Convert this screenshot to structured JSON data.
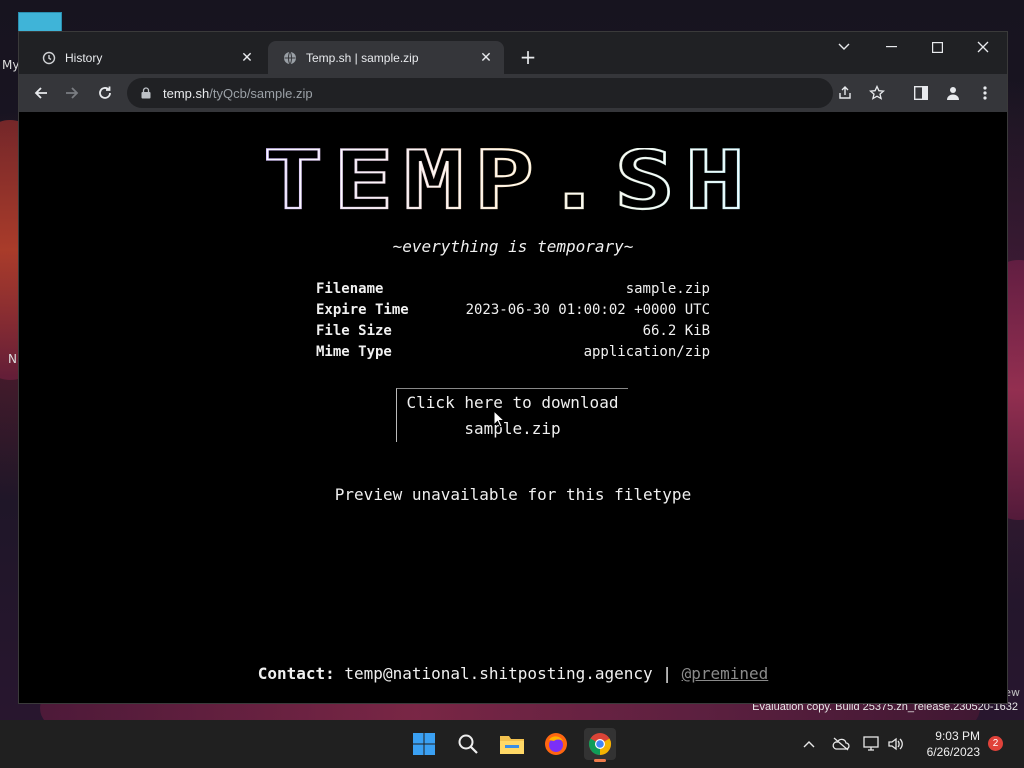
{
  "desktop": {
    "left_label_top": "My",
    "left_label_mid": "N",
    "watermark_small": "ew",
    "watermark": "Evaluation copy. Build 25375.zn_release.230520-1632"
  },
  "browser": {
    "tabs": [
      {
        "label": "History",
        "icon": "history-icon",
        "active": false
      },
      {
        "label": "Temp.sh | sample.zip",
        "icon": "globe-icon",
        "active": true
      }
    ],
    "url_host": "temp.sh",
    "url_path": "/tyQcb/sample.zip"
  },
  "page": {
    "logo_text": "TEMP.SH",
    "tagline": "~everything is temporary~",
    "info": [
      {
        "key": "Filename",
        "value": "sample.zip"
      },
      {
        "key": "Expire Time",
        "value": "2023-06-30 01:00:02 +0000 UTC"
      },
      {
        "key": "File Size",
        "value": "66.2 KiB"
      },
      {
        "key": "Mime Type",
        "value": "application/zip"
      }
    ],
    "download_line1": "Click here to download",
    "download_line2": "sample.zip",
    "preview_text": "Preview unavailable for this filetype",
    "contact_label": "Contact:",
    "contact_email": "temp@national.shitposting.agency",
    "contact_sep": "|",
    "contact_handle": "@premined"
  },
  "taskbar": {
    "time": "9:03 PM",
    "date": "6/26/2023",
    "notification_count": "2",
    "apps": [
      "start-icon",
      "search-icon",
      "file-explorer-icon",
      "firefox-icon",
      "chrome-icon"
    ]
  }
}
